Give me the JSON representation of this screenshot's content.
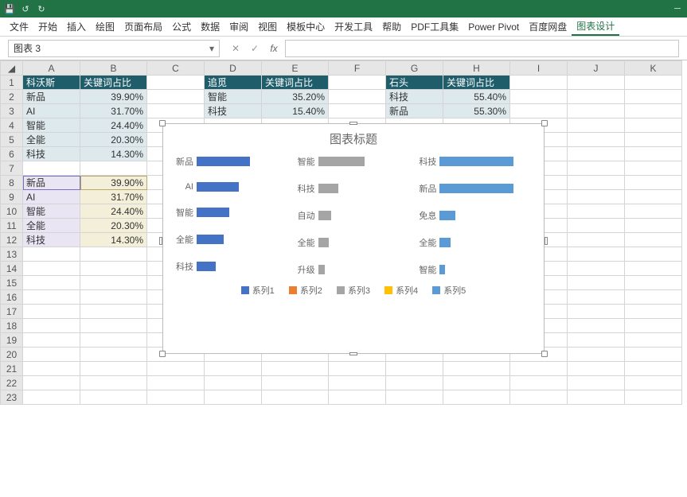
{
  "titlebar": {
    "user": ""
  },
  "ribbon": {
    "tabs": [
      "文件",
      "开始",
      "插入",
      "绘图",
      "页面布局",
      "公式",
      "数据",
      "审阅",
      "视图",
      "模板中心",
      "开发工具",
      "帮助",
      "PDF工具集",
      "Power Pivot",
      "百度网盘",
      "图表设计"
    ]
  },
  "formula_bar": {
    "namebox": "图表 3",
    "formula": ""
  },
  "columns": [
    "A",
    "B",
    "C",
    "D",
    "E",
    "F",
    "G",
    "H",
    "I",
    "J",
    "K"
  ],
  "rows": [
    1,
    2,
    3,
    4,
    5,
    6,
    7,
    8,
    9,
    10,
    11,
    12,
    13,
    14,
    15,
    16,
    17,
    18,
    19,
    20,
    21,
    22,
    23
  ],
  "t1": {
    "header": [
      "科沃斯",
      "关键词占比"
    ],
    "rows": [
      [
        "新品",
        "39.90%"
      ],
      [
        "AI",
        "31.70%"
      ],
      [
        "智能",
        "24.40%"
      ],
      [
        "全能",
        "20.30%"
      ],
      [
        "科技",
        "14.30%"
      ]
    ]
  },
  "t2": {
    "header": [
      "追觅",
      "关键词占比"
    ],
    "rows": [
      [
        "智能",
        "35.20%"
      ],
      [
        "科技",
        "15.40%"
      ]
    ]
  },
  "t3": {
    "header": [
      "石头",
      "关键词占比"
    ],
    "rows": [
      [
        "科技",
        "55.40%"
      ],
      [
        "新品",
        "55.30%"
      ]
    ]
  },
  "sel": {
    "a": [
      "新品",
      "AI",
      "智能",
      "全能",
      "科技"
    ],
    "b": [
      "39.90%",
      "31.70%",
      "24.40%",
      "20.30%",
      "14.30%"
    ]
  },
  "chart_data": {
    "type": "bar",
    "title": "图表标题",
    "series": [
      {
        "name": "系列1",
        "color": "#4472c4",
        "categories": [
          "新品",
          "AI",
          "智能",
          "全能",
          "科技"
        ],
        "values": [
          39.9,
          31.7,
          24.4,
          20.3,
          14.3
        ]
      },
      {
        "name": "系列2",
        "color": "#ed7d31",
        "categories": [],
        "values": []
      },
      {
        "name": "系列3",
        "color": "#a5a5a5",
        "categories": [
          "智能",
          "科技",
          "自动",
          "全能",
          "升级"
        ],
        "values": [
          35.2,
          15.4,
          10.0,
          8.0,
          5.0
        ]
      },
      {
        "name": "系列4",
        "color": "#ffc000",
        "categories": [],
        "values": []
      },
      {
        "name": "系列5",
        "color": "#5b9bd5",
        "categories": [
          "科技",
          "新品",
          "免息",
          "全能",
          "智能"
        ],
        "values": [
          55.4,
          55.3,
          12.0,
          8.0,
          4.0
        ]
      }
    ],
    "xlim": [
      0,
      60
    ]
  }
}
